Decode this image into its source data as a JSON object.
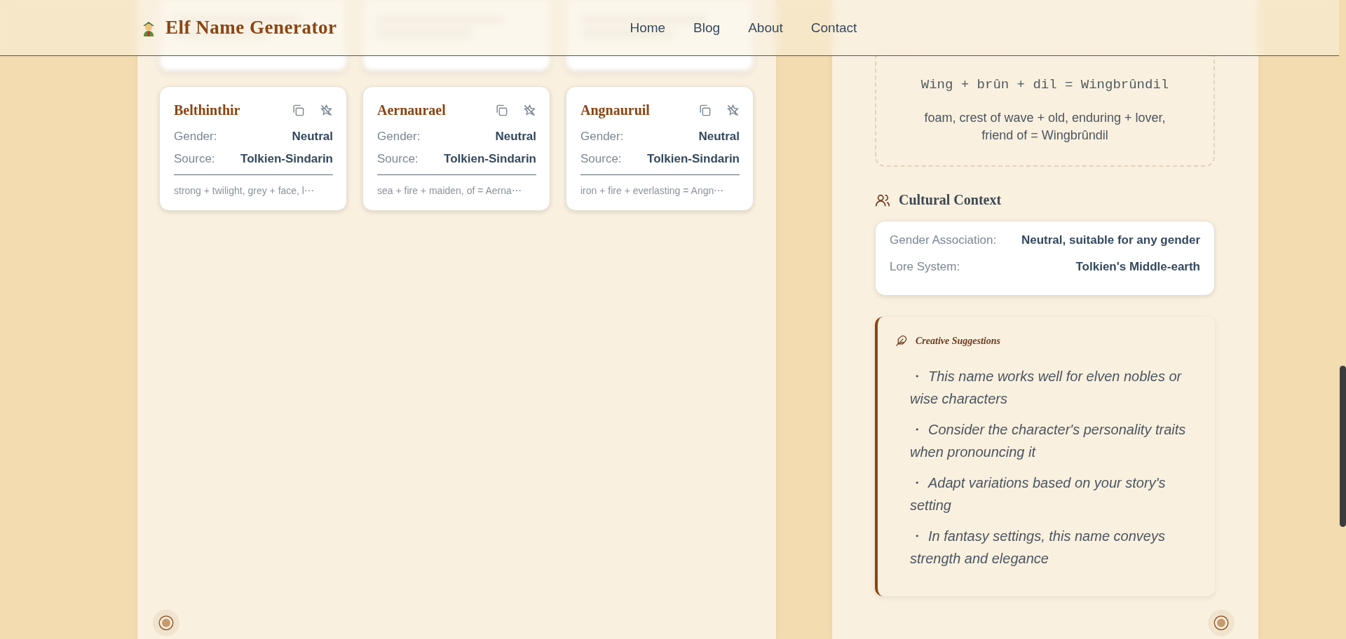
{
  "header": {
    "title": "Elf Name Generator",
    "nav": [
      {
        "label": "Home"
      },
      {
        "label": "Blog"
      },
      {
        "label": "About"
      },
      {
        "label": "Contact"
      }
    ]
  },
  "name_cards": [
    {
      "name": "Belthinthir",
      "gender_label": "Gender:",
      "gender": "Neutral",
      "source_label": "Source:",
      "source": "Tolkien-Sindarin",
      "meaning": "strong + twilight, grey + face, l⋯"
    },
    {
      "name": "Aernaurael",
      "gender_label": "Gender:",
      "gender": "Neutral",
      "source_label": "Source:",
      "source": "Tolkien-Sindarin",
      "meaning": "sea + fire + maiden, of = Aerna⋯"
    },
    {
      "name": "Angnauruil",
      "gender_label": "Gender:",
      "gender": "Neutral",
      "source_label": "Source:",
      "source": "Tolkien-Sindarin",
      "meaning": "iron + fire + everlasting = Angn⋯"
    }
  ],
  "etymology": {
    "formula": "Wing + brûn + dil = Wingbrûndil",
    "meaning": "foam, crest of wave + old, enduring + lover, friend of = Wingbrûndil"
  },
  "cultural_context": {
    "title": "Cultural Context",
    "rows": [
      {
        "label": "Gender Association:",
        "value": "Neutral, suitable for any gender"
      },
      {
        "label": "Lore System:",
        "value": "Tolkien's Middle-earth"
      }
    ]
  },
  "creative_suggestions": {
    "title": "Creative Suggestions",
    "items": [
      {
        "bullet": "・",
        "text": "This name works well for elven nobles or wise characters"
      },
      {
        "bullet": "・",
        "text": "Consider the character's personality traits when pronouncing it"
      },
      {
        "bullet": "・",
        "text": "Adapt variations based on your story's setting"
      },
      {
        "bullet": "・",
        "text": "In fantasy settings, this name conveys strength and elegance"
      }
    ]
  }
}
